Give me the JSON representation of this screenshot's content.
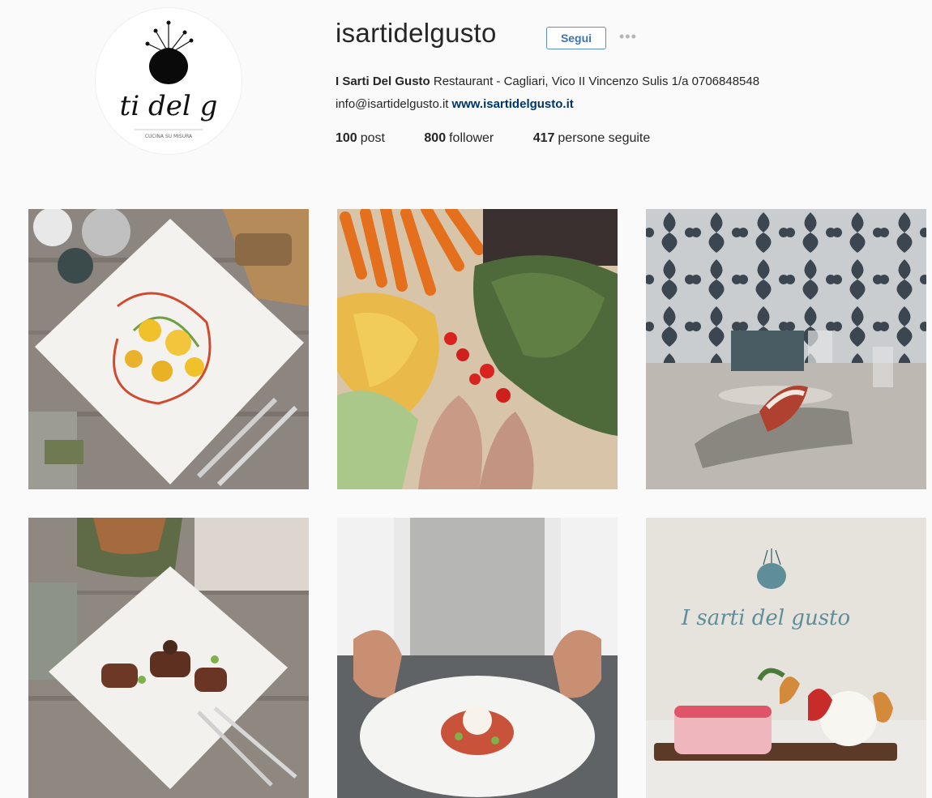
{
  "profile": {
    "username": "isartidelgusto",
    "follow_label": "Segui",
    "more_label": "•••",
    "bio_name": "I Sarti Del Gusto",
    "bio_text": " Restaurant - Cagliari, Vico II Vincenzo Sulis 1/a 0706848548",
    "email": "info@isartidelgusto.it",
    "website": "www.isartidelgusto.it",
    "avatar_script": "ti del g",
    "avatar_tagline": "CUCINA SU MISURA"
  },
  "stats": [
    {
      "count": "100",
      "label": "post"
    },
    {
      "count": "800",
      "label": "follower"
    },
    {
      "count": "417",
      "label": "persone seguite"
    }
  ],
  "posts": [
    {
      "subject": "pasta dish on white square plate"
    },
    {
      "subject": "vegetables, zucchini flowers, tomatoes"
    },
    {
      "subject": "table setting with damask wallpaper"
    },
    {
      "subject": "meat dish on white square plate"
    },
    {
      "subject": "chef holding a plate"
    },
    {
      "subject": "dessert with restaurant logo"
    }
  ],
  "tile6_script": "I sarti del gusto",
  "colors": {
    "accent": "#3b73b6",
    "link": "#003569",
    "background": "#fafafa"
  }
}
